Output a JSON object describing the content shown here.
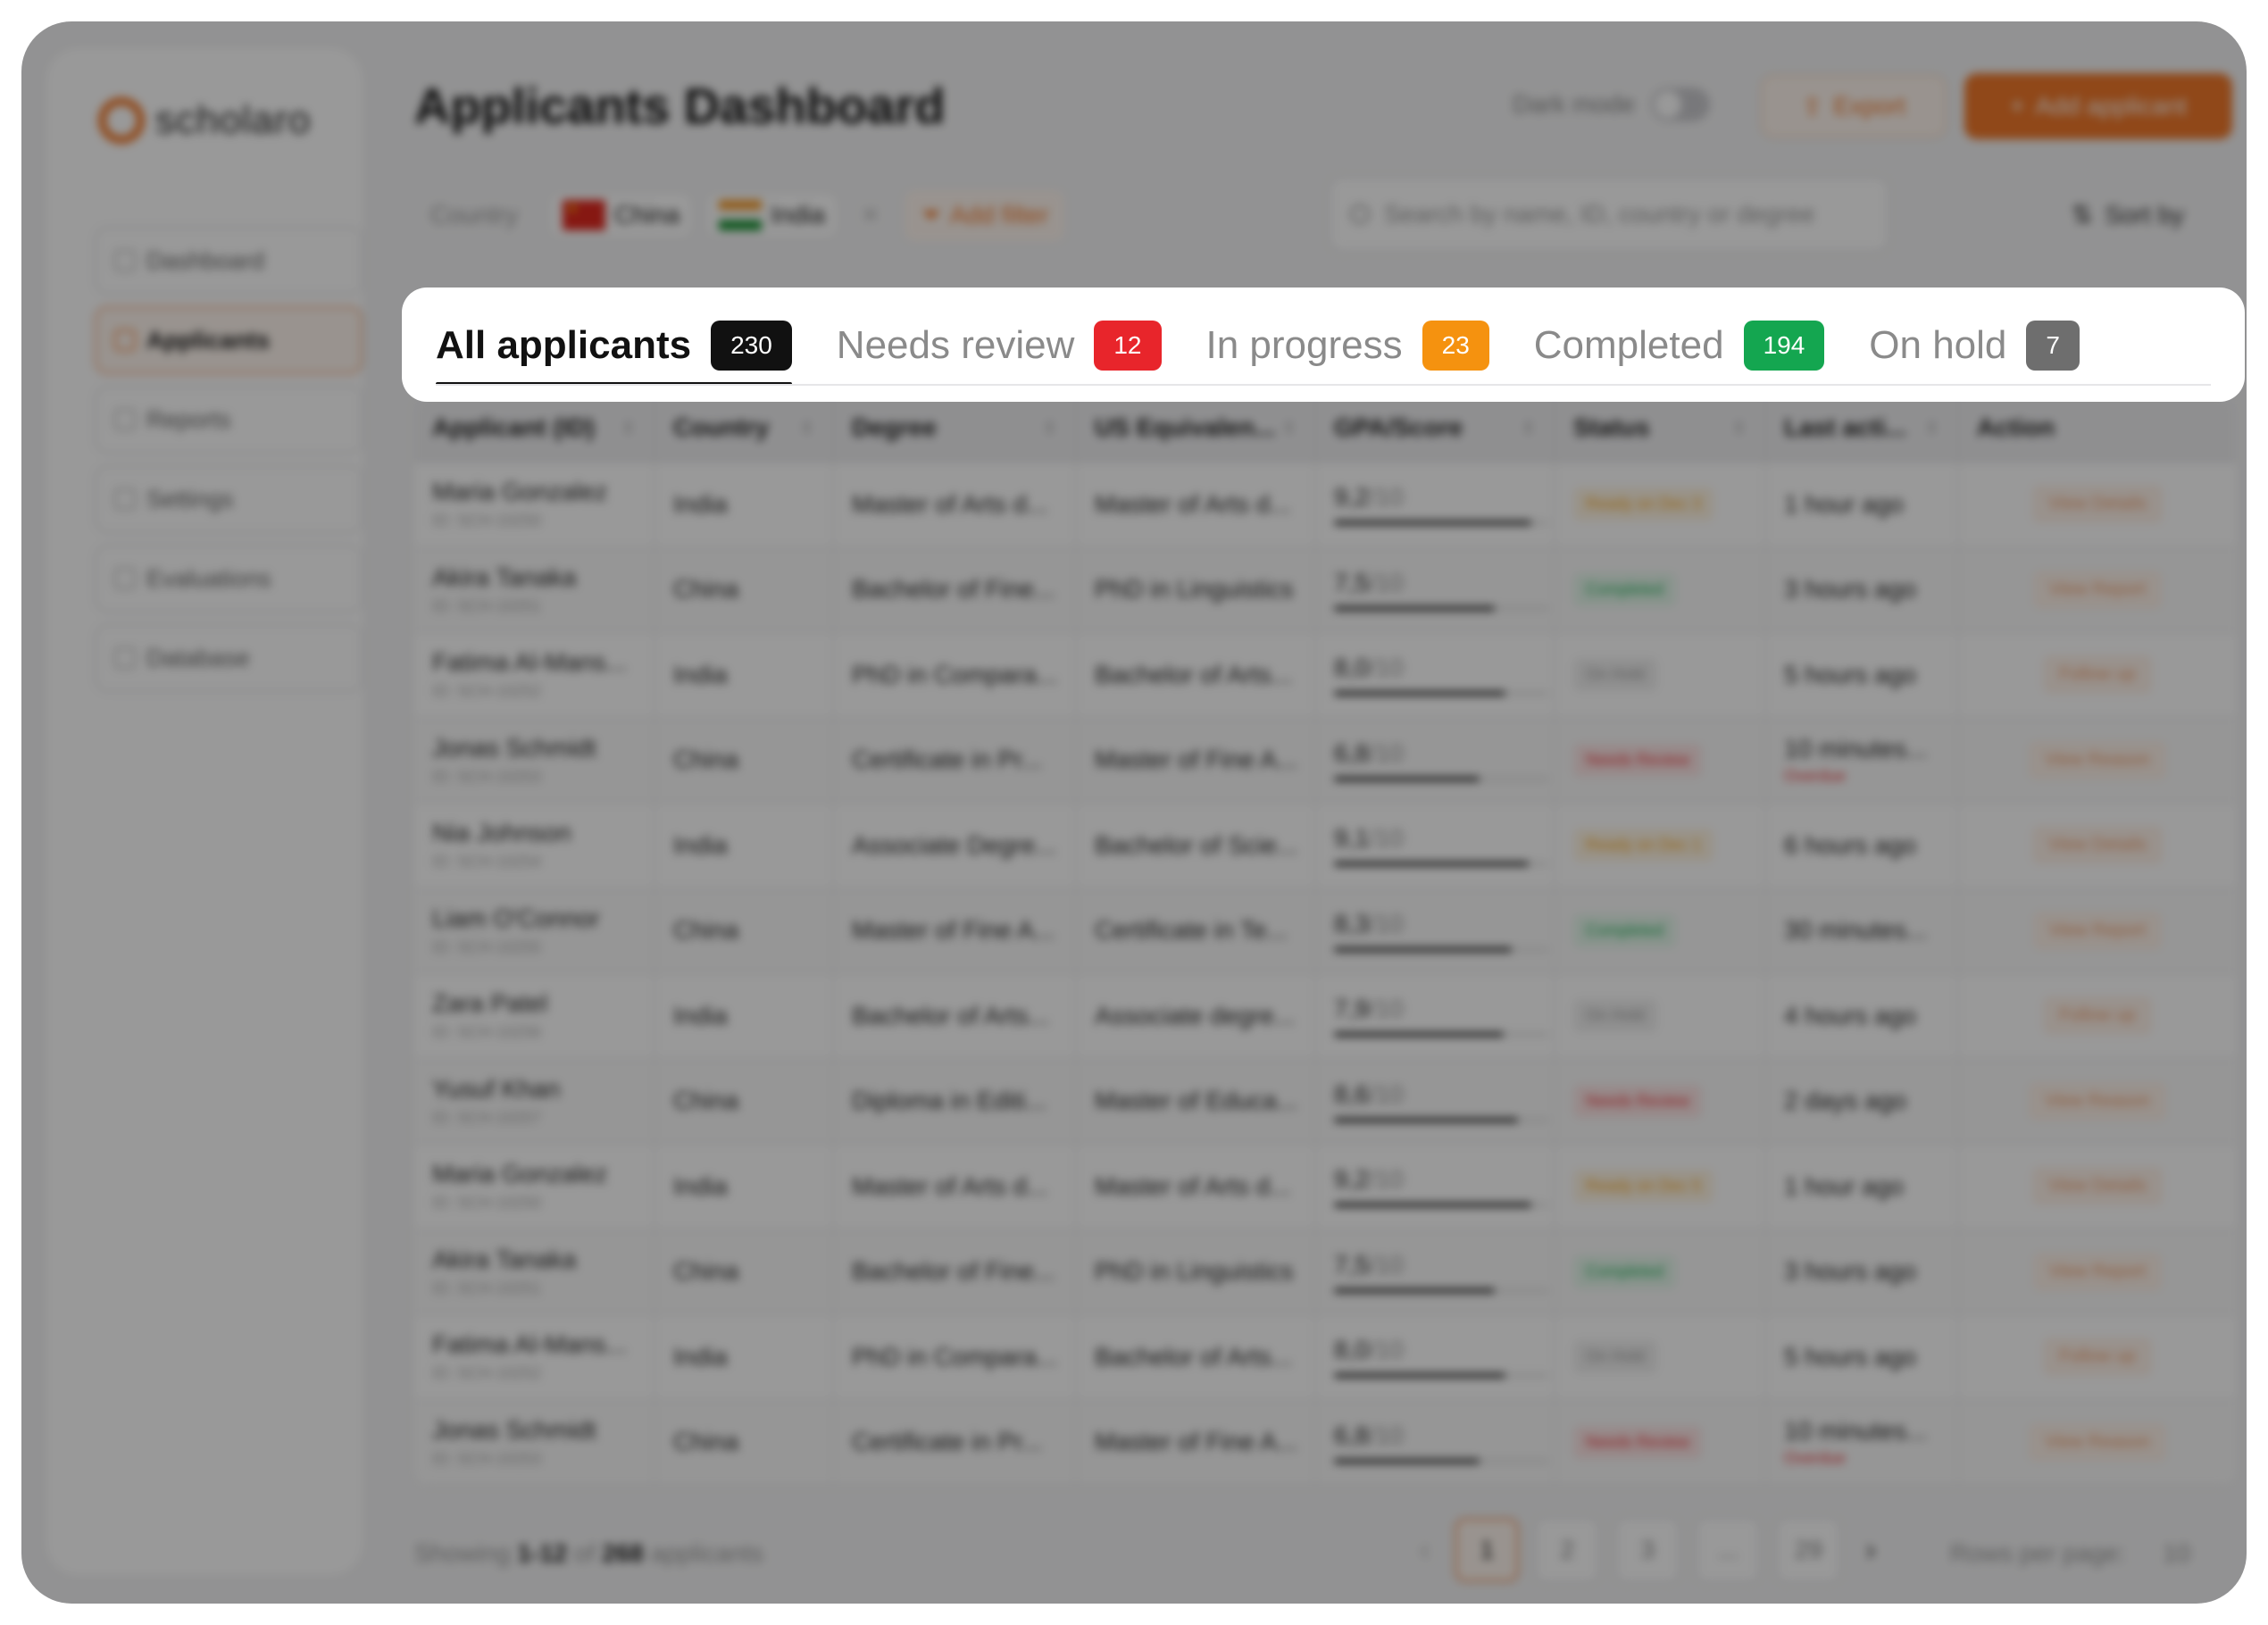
{
  "brand": {
    "name": "scholaro"
  },
  "nav": [
    {
      "label": "Dashboard",
      "active": false
    },
    {
      "label": "Applicants",
      "active": true
    },
    {
      "label": "Reports",
      "active": false
    },
    {
      "label": "Settings",
      "active": false
    },
    {
      "label": "Evaluations",
      "active": false
    },
    {
      "label": "Database",
      "active": false
    }
  ],
  "header": {
    "title": "Applicants Dashboard",
    "dark_mode_label": "Dark mode",
    "export_label": "Export",
    "add_label": "Add applicant"
  },
  "filters": {
    "label": "Country",
    "chips": [
      "China",
      "India"
    ],
    "clear": "×",
    "add_filter": "Add filter",
    "search_placeholder": "Search by name, ID, country or degree",
    "sort_label": "Sort by"
  },
  "tabs": [
    {
      "label": "All applicants",
      "count": "230",
      "color": "#111111",
      "active": true
    },
    {
      "label": "Needs review",
      "count": "12",
      "color": "#e8252b",
      "active": false
    },
    {
      "label": "In progress",
      "count": "23",
      "color": "#f5920f",
      "active": false
    },
    {
      "label": "Completed",
      "count": "194",
      "color": "#14a650",
      "active": false
    },
    {
      "label": "On hold",
      "count": "7",
      "color": "#6e6e6e",
      "active": false
    }
  ],
  "table": {
    "columns": [
      "Applicant (ID)",
      "Country",
      "Degree",
      "US Equivalen...",
      "GPA/Score",
      "Status",
      "Last acti...",
      "Action"
    ],
    "rows": [
      {
        "name": "Maria Gonzalez",
        "id": "ID: SCH-10250",
        "country": "India",
        "degree": "Master of Arts d...",
        "equiv": "Master of Arts d...",
        "gpa": "9,2",
        "gpa_den": "/10",
        "gpa_value": 9.2,
        "status": "Ready on Dec 3",
        "status_type": "ready",
        "last": "1 hour ago",
        "overdue": "",
        "action": "View Details"
      },
      {
        "name": "Akira Tanaka",
        "id": "ID: SCH-10251",
        "country": "China",
        "degree": "Bachelor of Fine...",
        "equiv": "PhD in Linguistics",
        "gpa": "7,5",
        "gpa_den": "/10",
        "gpa_value": 7.5,
        "status": "Completed",
        "status_type": "completed",
        "last": "3 hours ago",
        "overdue": "",
        "action": "View Report"
      },
      {
        "name": "Fatima Al-Mans...",
        "id": "ID: SCH-10252",
        "country": "India",
        "degree": "PhD in Compara...",
        "equiv": "Bachelor of Arts...",
        "gpa": "8,0",
        "gpa_den": "/10",
        "gpa_value": 8.0,
        "status": "On Hold",
        "status_type": "hold",
        "last": "5 hours ago",
        "overdue": "",
        "action": "Follow up"
      },
      {
        "name": "Jonas Schmidt",
        "id": "ID: SCH-10253",
        "country": "China",
        "degree": "Certificate in Pr...",
        "equiv": "Master of Fine A...",
        "gpa": "6,8",
        "gpa_den": "/10",
        "gpa_value": 6.8,
        "status": "Needs Review",
        "status_type": "review",
        "last": "10 minutes...",
        "overdue": "Overdue",
        "action": "View Reason"
      },
      {
        "name": "Nia Johnson",
        "id": "ID: SCH-10254",
        "country": "India",
        "degree": "Associate Degre...",
        "equiv": "Bachelor of Scie...",
        "gpa": "9,1",
        "gpa_den": "/10",
        "gpa_value": 9.1,
        "status": "Ready on Dec 1",
        "status_type": "ready",
        "last": "6 hours ago",
        "overdue": "",
        "action": "View Details"
      },
      {
        "name": "Liam O'Connor",
        "id": "ID: SCH-10255",
        "country": "China",
        "degree": "Master of Fine A...",
        "equiv": "Certificate in Te...",
        "gpa": "8,3",
        "gpa_den": "/10",
        "gpa_value": 8.3,
        "status": "Completed",
        "status_type": "completed",
        "last": "30 minutes...",
        "overdue": "",
        "action": "View Report"
      },
      {
        "name": "Zara Patel",
        "id": "ID: SCH-10256",
        "country": "India",
        "degree": "Bachelor of Arts...",
        "equiv": "Associate degre...",
        "gpa": "7,9",
        "gpa_den": "/10",
        "gpa_value": 7.9,
        "status": "On Hold",
        "status_type": "hold",
        "last": "4 hours ago",
        "overdue": "",
        "action": "Follow up"
      },
      {
        "name": "Yusuf Khan",
        "id": "ID: SCH-10257",
        "country": "China",
        "degree": "Diploma in Editi...",
        "equiv": "Master of Educa...",
        "gpa": "8,6",
        "gpa_den": "/10",
        "gpa_value": 8.6,
        "status": "Needs Review",
        "status_type": "review",
        "last": "2 days ago",
        "overdue": "",
        "action": "View Reason"
      },
      {
        "name": "Maria Gonzalez",
        "id": "ID: SCH-10250",
        "country": "India",
        "degree": "Master of Arts d...",
        "equiv": "Master of Arts d...",
        "gpa": "9,2",
        "gpa_den": "/10",
        "gpa_value": 9.2,
        "status": "Ready on Dec 5",
        "status_type": "ready",
        "last": "1 hour ago",
        "overdue": "",
        "action": "View Details"
      },
      {
        "name": "Akira Tanaka",
        "id": "ID: SCH-10251",
        "country": "China",
        "degree": "Bachelor of Fine...",
        "equiv": "PhD in Linguistics",
        "gpa": "7,5",
        "gpa_den": "/10",
        "gpa_value": 7.5,
        "status": "Completed",
        "status_type": "completed",
        "last": "3 hours ago",
        "overdue": "",
        "action": "View Report"
      },
      {
        "name": "Fatima Al-Mans...",
        "id": "ID: SCH-10252",
        "country": "India",
        "degree": "PhD in Compara...",
        "equiv": "Bachelor of Arts...",
        "gpa": "8,0",
        "gpa_den": "/10",
        "gpa_value": 8.0,
        "status": "On Hold",
        "status_type": "hold",
        "last": "5 hours ago",
        "overdue": "",
        "action": "Follow up"
      },
      {
        "name": "Jonas Schmidt",
        "id": "ID: SCH-10253",
        "country": "China",
        "degree": "Certificate in Pr...",
        "equiv": "Master of Fine A...",
        "gpa": "6,8",
        "gpa_den": "/10",
        "gpa_value": 6.8,
        "status": "Needs Review",
        "status_type": "review",
        "last": "10 minutes...",
        "overdue": "Overdue",
        "action": "View Reason"
      }
    ]
  },
  "footer": {
    "showing_prefix": "Showing",
    "range": "1-12",
    "of": "of",
    "total": "268",
    "suffix": "applicants",
    "pages": [
      "1",
      "2",
      "3",
      "...",
      "29"
    ],
    "active_page": "1",
    "rows_per_page_label": "Rows per page:",
    "rows_per_page_value": "10"
  }
}
